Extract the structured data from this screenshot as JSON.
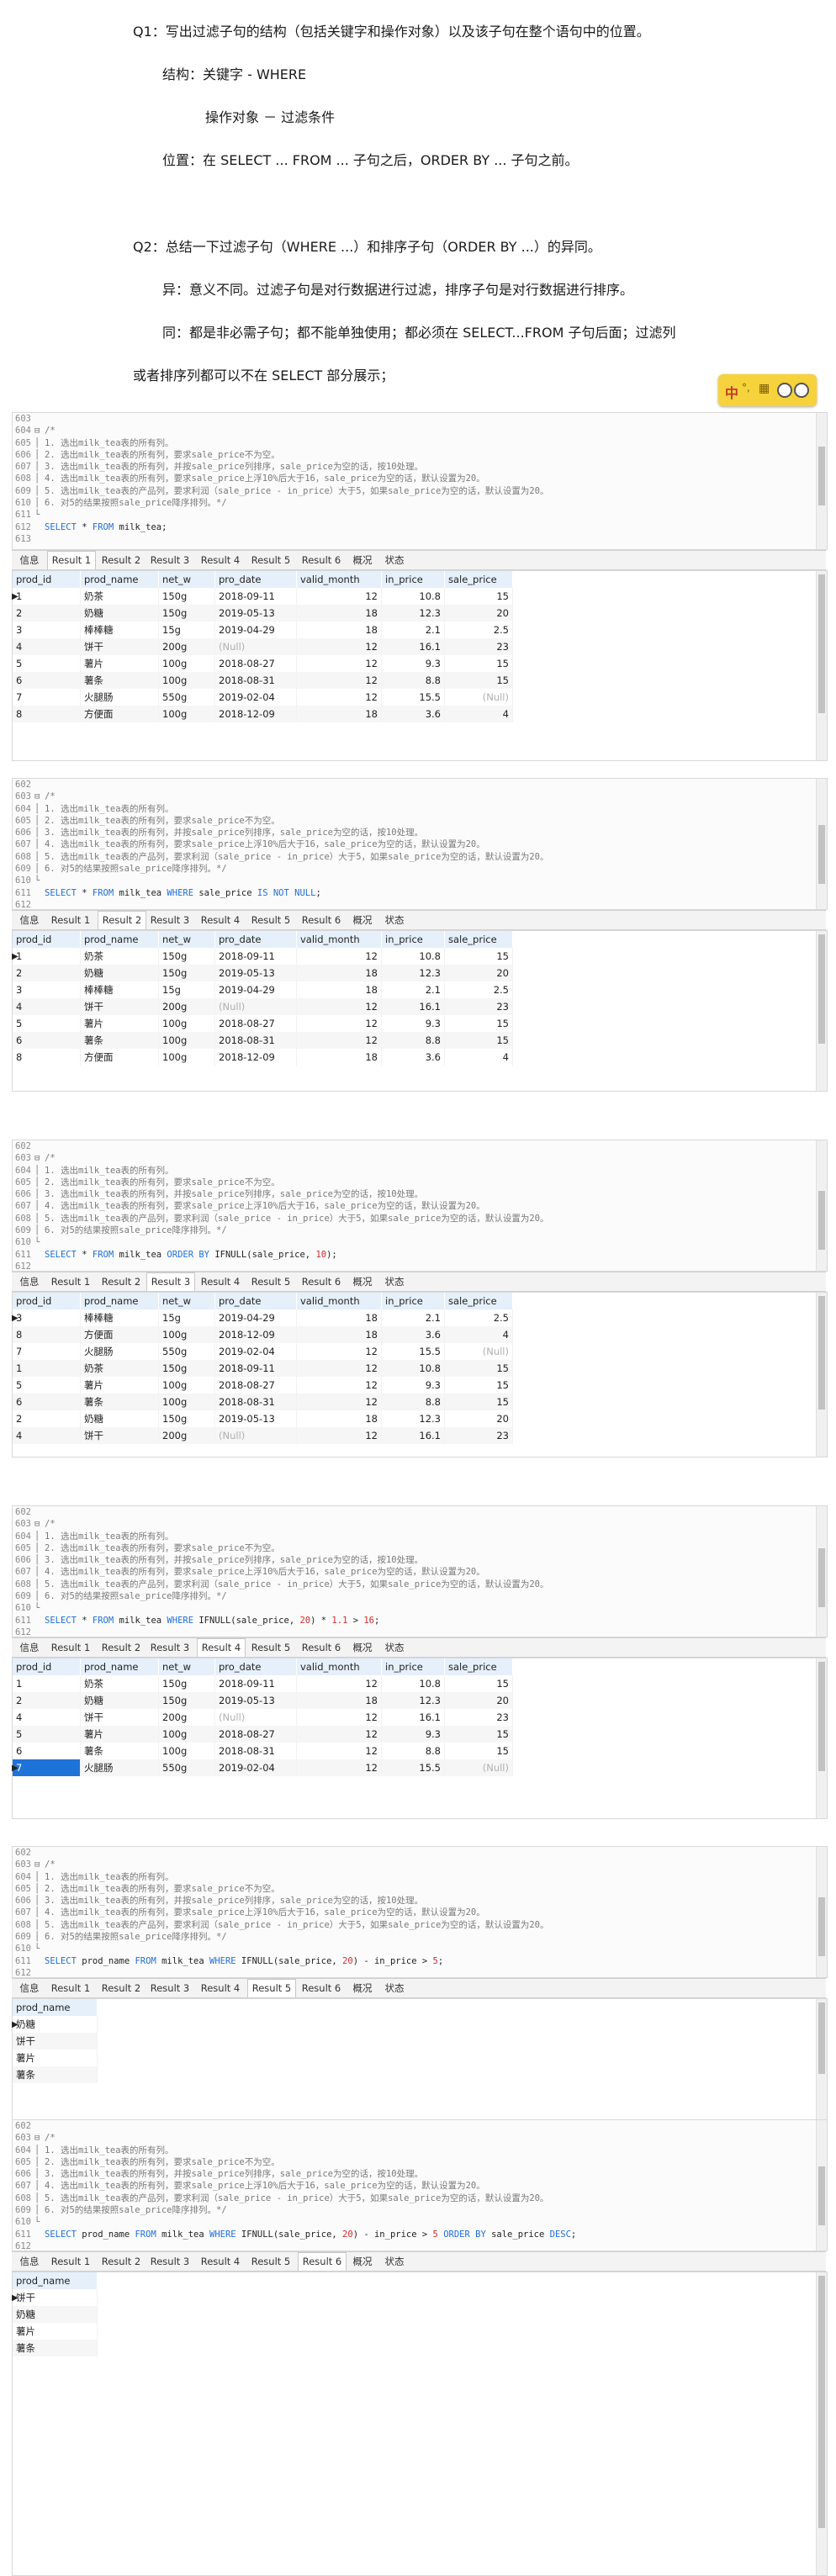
{
  "notes": [
    "Q1：写出过滤子句的结构（包括关键字和操作对象）以及该子句在整个语句中的位置。",
    "结构：关键字  - WHERE",
    "操作对象  －  过滤条件",
    "位置：在 SELECT ... FROM ...  子句之后，ORDER BY ...  子句之前。",
    "Q2：总结一下过滤子句（WHERE ...）和排序子句（ORDER BY ...）的异同。",
    "异：意义不同。过滤子句是对行数据进行过滤，排序子句是对行数据进行排序。",
    "同：都是非必需子句；都不能单独使用；都必须在 SELECT...FROM 子句后面；过滤列",
    "或者排序列都可以不在 SELECT 部分展示；"
  ],
  "ime": {
    "label": "中",
    "extra": "°,",
    "icon": "keyboard-icon"
  },
  "comment_lines": [
    "/*",
    "1. 选出milk_tea表的所有列。",
    "2. 选出milk_tea表的所有列，要求sale_price不为空。",
    "3. 选出milk_tea表的所有列，并按sale_price列排序，sale_price为空的话，按10处理。",
    "4. 选出milk_tea表的所有列，要求sale_price上浮10%后大于16，sale_price为空的话，默认设置为20。",
    "5. 选出milk_tea表的产品列，要求利润（sale_price - in_price）大于5，如果sale_price为空的话，默认设置为20。",
    "6. 对5的结果按照sale_price降序排列。*/"
  ],
  "tabs": [
    "信息",
    "Result 1",
    "Result 2",
    "Result 3",
    "Result 4",
    "Result 5",
    "Result 6",
    "概况",
    "状态"
  ],
  "columns": [
    "prod_id",
    "prod_name",
    "net_w",
    "pro_date",
    "valid_month",
    "in_price",
    "sale_price"
  ],
  "panels": [
    {
      "line_numbers": [
        "603",
        "604",
        "605",
        "606",
        "607",
        "608",
        "609",
        "610",
        "611",
        "612",
        "613"
      ],
      "active_tab": 1,
      "sql": [
        {
          "t": "SELECT",
          "c": "kw"
        },
        {
          "t": " * ",
          "c": "idt"
        },
        {
          "t": "FROM",
          "c": "kw"
        },
        {
          "t": " milk_tea;",
          "c": "idt"
        }
      ],
      "rows": [
        [
          "1",
          "奶茶",
          "150g",
          "2018-09-11",
          "12",
          "10.8",
          "15"
        ],
        [
          "2",
          "奶糖",
          "150g",
          "2019-05-13",
          "18",
          "12.3",
          "20"
        ],
        [
          "3",
          "棒棒糖",
          "15g",
          "2019-04-29",
          "18",
          "2.1",
          "2.5"
        ],
        [
          "4",
          "饼干",
          "200g",
          "(Null)",
          "12",
          "16.1",
          "23"
        ],
        [
          "5",
          "薯片",
          "100g",
          "2018-08-27",
          "12",
          "9.3",
          "15"
        ],
        [
          "6",
          "薯条",
          "100g",
          "2018-08-31",
          "12",
          "8.8",
          "15"
        ],
        [
          "7",
          "火腿肠",
          "550g",
          "2019-02-04",
          "12",
          "15.5",
          "(Null)"
        ],
        [
          "8",
          "方便面",
          "100g",
          "2018-12-09",
          "18",
          "3.6",
          "4"
        ]
      ]
    },
    {
      "line_numbers": [
        "602",
        "603",
        "604",
        "605",
        "606",
        "607",
        "608",
        "609",
        "610",
        "611",
        "612"
      ],
      "active_tab": 2,
      "sql": [
        {
          "t": "SELECT",
          "c": "kw"
        },
        {
          "t": " * ",
          "c": "idt"
        },
        {
          "t": "FROM",
          "c": "kw"
        },
        {
          "t": " milk_tea ",
          "c": "idt"
        },
        {
          "t": "WHERE",
          "c": "kw"
        },
        {
          "t": " sale_price ",
          "c": "idt"
        },
        {
          "t": "IS NOT NULL",
          "c": "kw"
        },
        {
          "t": ";",
          "c": "idt"
        }
      ],
      "rows": [
        [
          "1",
          "奶茶",
          "150g",
          "2018-09-11",
          "12",
          "10.8",
          "15"
        ],
        [
          "2",
          "奶糖",
          "150g",
          "2019-05-13",
          "18",
          "12.3",
          "20"
        ],
        [
          "3",
          "棒棒糖",
          "15g",
          "2019-04-29",
          "18",
          "2.1",
          "2.5"
        ],
        [
          "4",
          "饼干",
          "200g",
          "(Null)",
          "12",
          "16.1",
          "23"
        ],
        [
          "5",
          "薯片",
          "100g",
          "2018-08-27",
          "12",
          "9.3",
          "15"
        ],
        [
          "6",
          "薯条",
          "100g",
          "2018-08-31",
          "12",
          "8.8",
          "15"
        ],
        [
          "8",
          "方便面",
          "100g",
          "2018-12-09",
          "18",
          "3.6",
          "4"
        ]
      ]
    },
    {
      "line_numbers": [
        "602",
        "603",
        "604",
        "605",
        "606",
        "607",
        "608",
        "609",
        "610",
        "611",
        "612"
      ],
      "active_tab": 3,
      "sql": [
        {
          "t": "SELECT",
          "c": "kw"
        },
        {
          "t": " * ",
          "c": "idt"
        },
        {
          "t": "FROM",
          "c": "kw"
        },
        {
          "t": " milk_tea ",
          "c": "idt"
        },
        {
          "t": "ORDER BY",
          "c": "kw"
        },
        {
          "t": " IFNULL(sale_price, ",
          "c": "idt"
        },
        {
          "t": "10",
          "c": "num"
        },
        {
          "t": ");",
          "c": "idt"
        }
      ],
      "rows": [
        [
          "3",
          "棒棒糖",
          "15g",
          "2019-04-29",
          "18",
          "2.1",
          "2.5"
        ],
        [
          "8",
          "方便面",
          "100g",
          "2018-12-09",
          "18",
          "3.6",
          "4"
        ],
        [
          "7",
          "火腿肠",
          "550g",
          "2019-02-04",
          "12",
          "15.5",
          "(Null)"
        ],
        [
          "1",
          "奶茶",
          "150g",
          "2018-09-11",
          "12",
          "10.8",
          "15"
        ],
        [
          "5",
          "薯片",
          "100g",
          "2018-08-27",
          "12",
          "9.3",
          "15"
        ],
        [
          "6",
          "薯条",
          "100g",
          "2018-08-31",
          "12",
          "8.8",
          "15"
        ],
        [
          "2",
          "奶糖",
          "150g",
          "2019-05-13",
          "18",
          "12.3",
          "20"
        ],
        [
          "4",
          "饼干",
          "200g",
          "(Null)",
          "12",
          "16.1",
          "23"
        ]
      ]
    },
    {
      "line_numbers": [
        "602",
        "603",
        "604",
        "605",
        "606",
        "607",
        "608",
        "609",
        "610",
        "611",
        "612"
      ],
      "active_tab": 4,
      "sql": [
        {
          "t": "SELECT",
          "c": "kw"
        },
        {
          "t": " * ",
          "c": "idt"
        },
        {
          "t": "FROM",
          "c": "kw"
        },
        {
          "t": " milk_tea ",
          "c": "idt"
        },
        {
          "t": "WHERE",
          "c": "kw"
        },
        {
          "t": " IFNULL(sale_price, ",
          "c": "idt"
        },
        {
          "t": "20",
          "c": "num"
        },
        {
          "t": ") * ",
          "c": "idt"
        },
        {
          "t": "1.1",
          "c": "num"
        },
        {
          "t": " > ",
          "c": "idt"
        },
        {
          "t": "16",
          "c": "num"
        },
        {
          "t": ";",
          "c": "idt"
        }
      ],
      "rows": [
        [
          "1",
          "奶茶",
          "150g",
          "2018-09-11",
          "12",
          "10.8",
          "15"
        ],
        [
          "2",
          "奶糖",
          "150g",
          "2019-05-13",
          "18",
          "12.3",
          "20"
        ],
        [
          "4",
          "饼干",
          "200g",
          "(Null)",
          "12",
          "16.1",
          "23"
        ],
        [
          "5",
          "薯片",
          "100g",
          "2018-08-27",
          "12",
          "9.3",
          "15"
        ],
        [
          "6",
          "薯条",
          "100g",
          "2018-08-31",
          "12",
          "8.8",
          "15"
        ],
        [
          "7",
          "火腿肠",
          "550g",
          "2019-02-04",
          "12",
          "15.5",
          "(Null)"
        ]
      ]
    },
    {
      "line_numbers": [
        "602",
        "603",
        "604",
        "605",
        "606",
        "607",
        "608",
        "609",
        "610",
        "611",
        "612"
      ],
      "active_tab": 5,
      "sql": [
        {
          "t": "SELECT",
          "c": "kw"
        },
        {
          "t": " prod_name ",
          "c": "idt"
        },
        {
          "t": "FROM",
          "c": "kw"
        },
        {
          "t": " milk_tea ",
          "c": "idt"
        },
        {
          "t": "WHERE",
          "c": "kw"
        },
        {
          "t": " IFNULL(sale_price, ",
          "c": "idt"
        },
        {
          "t": "20",
          "c": "num"
        },
        {
          "t": ") - in_price > ",
          "c": "idt"
        },
        {
          "t": "5",
          "c": "num"
        },
        {
          "t": ";",
          "c": "idt"
        }
      ],
      "columns": [
        "prod_name"
      ],
      "rows": [
        [
          "奶糖"
        ],
        [
          "饼干"
        ],
        [
          "薯片"
        ],
        [
          "薯条"
        ]
      ]
    },
    {
      "line_numbers": [
        "602",
        "603",
        "604",
        "605",
        "606",
        "607",
        "608",
        "609",
        "610",
        "611",
        "612"
      ],
      "active_tab": 6,
      "sql": [
        {
          "t": "SELECT",
          "c": "kw"
        },
        {
          "t": " prod_name ",
          "c": "idt"
        },
        {
          "t": "FROM",
          "c": "kw"
        },
        {
          "t": " milk_tea ",
          "c": "idt"
        },
        {
          "t": "WHERE",
          "c": "kw"
        },
        {
          "t": " IFNULL(sale_price, ",
          "c": "idt"
        },
        {
          "t": "20",
          "c": "num"
        },
        {
          "t": ") - in_price > ",
          "c": "idt"
        },
        {
          "t": "5",
          "c": "num"
        },
        {
          "t": " ",
          "c": "idt"
        },
        {
          "t": "ORDER BY",
          "c": "kw"
        },
        {
          "t": " sale_price ",
          "c": "idt"
        },
        {
          "t": "DESC",
          "c": "kw"
        },
        {
          "t": ";",
          "c": "idt"
        }
      ],
      "columns": [
        "prod_name"
      ],
      "rows": [
        [
          "饼干"
        ],
        [
          "奶糖"
        ],
        [
          "薯片"
        ],
        [
          "薯条"
        ]
      ]
    }
  ]
}
